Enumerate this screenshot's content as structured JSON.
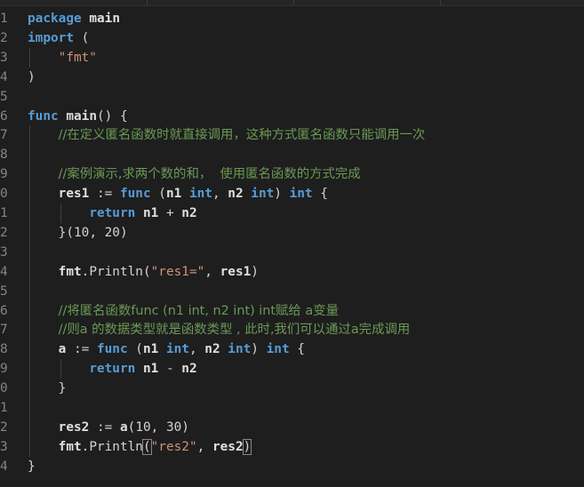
{
  "editor": {
    "lines": [
      {
        "n": "1",
        "tokens": [
          {
            "t": "kw",
            "v": "package"
          },
          {
            "t": "op",
            "v": " "
          },
          {
            "t": "id",
            "v": "main"
          }
        ]
      },
      {
        "n": "2",
        "tokens": [
          {
            "t": "kw",
            "v": "import"
          },
          {
            "t": "op",
            "v": " ("
          }
        ]
      },
      {
        "n": "3",
        "tokens": [
          {
            "t": "op",
            "v": "    "
          },
          {
            "t": "str",
            "v": "\"fmt\""
          }
        ]
      },
      {
        "n": "4",
        "tokens": [
          {
            "t": "op",
            "v": ")"
          }
        ]
      },
      {
        "n": "5",
        "tokens": []
      },
      {
        "n": "6",
        "tokens": [
          {
            "t": "kw",
            "v": "func"
          },
          {
            "t": "op",
            "v": " "
          },
          {
            "t": "fn",
            "v": "main"
          },
          {
            "t": "op",
            "v": "() {"
          }
        ]
      },
      {
        "n": "7",
        "tokens": [
          {
            "t": "op",
            "v": "    "
          },
          {
            "t": "cmt",
            "v": "//在定义匿名函数时就直接调用，这种方式匿名函数只能调用一次"
          }
        ]
      },
      {
        "n": "8",
        "tokens": []
      },
      {
        "n": "9",
        "tokens": [
          {
            "t": "op",
            "v": "    "
          },
          {
            "t": "cmt",
            "v": "//案例演示,求两个数的和，  使用匿名函数的方式完成"
          }
        ]
      },
      {
        "n": "0",
        "tokens": [
          {
            "t": "op",
            "v": "    "
          },
          {
            "t": "id",
            "v": "res1"
          },
          {
            "t": "op",
            "v": " := "
          },
          {
            "t": "kw",
            "v": "func"
          },
          {
            "t": "op",
            "v": " ("
          },
          {
            "t": "id",
            "v": "n1"
          },
          {
            "t": "op",
            "v": " "
          },
          {
            "t": "kw",
            "v": "int"
          },
          {
            "t": "op",
            "v": ", "
          },
          {
            "t": "id",
            "v": "n2"
          },
          {
            "t": "op",
            "v": " "
          },
          {
            "t": "kw",
            "v": "int"
          },
          {
            "t": "op",
            "v": ") "
          },
          {
            "t": "kw",
            "v": "int"
          },
          {
            "t": "op",
            "v": " {"
          }
        ]
      },
      {
        "n": "1",
        "tokens": [
          {
            "t": "op",
            "v": "        "
          },
          {
            "t": "kw",
            "v": "return"
          },
          {
            "t": "op",
            "v": " "
          },
          {
            "t": "id",
            "v": "n1"
          },
          {
            "t": "op",
            "v": " + "
          },
          {
            "t": "id",
            "v": "n2"
          }
        ]
      },
      {
        "n": "2",
        "tokens": [
          {
            "t": "op",
            "v": "    }("
          },
          {
            "t": "num",
            "v": "10"
          },
          {
            "t": "op",
            "v": ", "
          },
          {
            "t": "num",
            "v": "20"
          },
          {
            "t": "op",
            "v": ")"
          }
        ]
      },
      {
        "n": "3",
        "tokens": []
      },
      {
        "n": "4",
        "tokens": [
          {
            "t": "op",
            "v": "    "
          },
          {
            "t": "id",
            "v": "fmt"
          },
          {
            "t": "op",
            "v": ".Println("
          },
          {
            "t": "str",
            "v": "\"res1=\""
          },
          {
            "t": "op",
            "v": ", "
          },
          {
            "t": "id",
            "v": "res1"
          },
          {
            "t": "op",
            "v": ")"
          }
        ]
      },
      {
        "n": "5",
        "tokens": []
      },
      {
        "n": "6",
        "tokens": [
          {
            "t": "op",
            "v": "    "
          },
          {
            "t": "cmt",
            "v": "//将匿名函数func (n1 int, n2 int) int赋给 a变量"
          }
        ]
      },
      {
        "n": "7",
        "tokens": [
          {
            "t": "op",
            "v": "    "
          },
          {
            "t": "cmt",
            "v": "//则a 的数据类型就是函数类型 , 此时,我们可以通过a完成调用"
          }
        ]
      },
      {
        "n": "8",
        "tokens": [
          {
            "t": "op",
            "v": "    "
          },
          {
            "t": "id",
            "v": "a"
          },
          {
            "t": "op",
            "v": " := "
          },
          {
            "t": "kw",
            "v": "func"
          },
          {
            "t": "op",
            "v": " ("
          },
          {
            "t": "id",
            "v": "n1"
          },
          {
            "t": "op",
            "v": " "
          },
          {
            "t": "kw",
            "v": "int"
          },
          {
            "t": "op",
            "v": ", "
          },
          {
            "t": "id",
            "v": "n2"
          },
          {
            "t": "op",
            "v": " "
          },
          {
            "t": "kw",
            "v": "int"
          },
          {
            "t": "op",
            "v": ") "
          },
          {
            "t": "kw",
            "v": "int"
          },
          {
            "t": "op",
            "v": " {"
          }
        ]
      },
      {
        "n": "9",
        "tokens": [
          {
            "t": "op",
            "v": "        "
          },
          {
            "t": "kw",
            "v": "return"
          },
          {
            "t": "op",
            "v": " "
          },
          {
            "t": "id",
            "v": "n1"
          },
          {
            "t": "op",
            "v": " - "
          },
          {
            "t": "id",
            "v": "n2"
          }
        ]
      },
      {
        "n": "0",
        "tokens": [
          {
            "t": "op",
            "v": "    }"
          }
        ]
      },
      {
        "n": "1",
        "tokens": []
      },
      {
        "n": "2",
        "tokens": [
          {
            "t": "op",
            "v": "    "
          },
          {
            "t": "id",
            "v": "res2"
          },
          {
            "t": "op",
            "v": " := "
          },
          {
            "t": "id",
            "v": "a"
          },
          {
            "t": "op",
            "v": "("
          },
          {
            "t": "num",
            "v": "10"
          },
          {
            "t": "op",
            "v": ", "
          },
          {
            "t": "num",
            "v": "30"
          },
          {
            "t": "op",
            "v": ")"
          }
        ]
      },
      {
        "n": "3",
        "tokens": [
          {
            "t": "op",
            "v": "    "
          },
          {
            "t": "id",
            "v": "fmt"
          },
          {
            "t": "op",
            "v": ".Println"
          },
          {
            "t": "op",
            "v": "("
          },
          {
            "t": "str",
            "v": "\"res2\""
          },
          {
            "t": "op",
            "v": ", "
          },
          {
            "t": "id",
            "v": "res2"
          },
          {
            "t": "op",
            "v": ")"
          }
        ]
      },
      {
        "n": "4",
        "tokens": [
          {
            "t": "op",
            "v": "}"
          }
        ]
      }
    ]
  }
}
